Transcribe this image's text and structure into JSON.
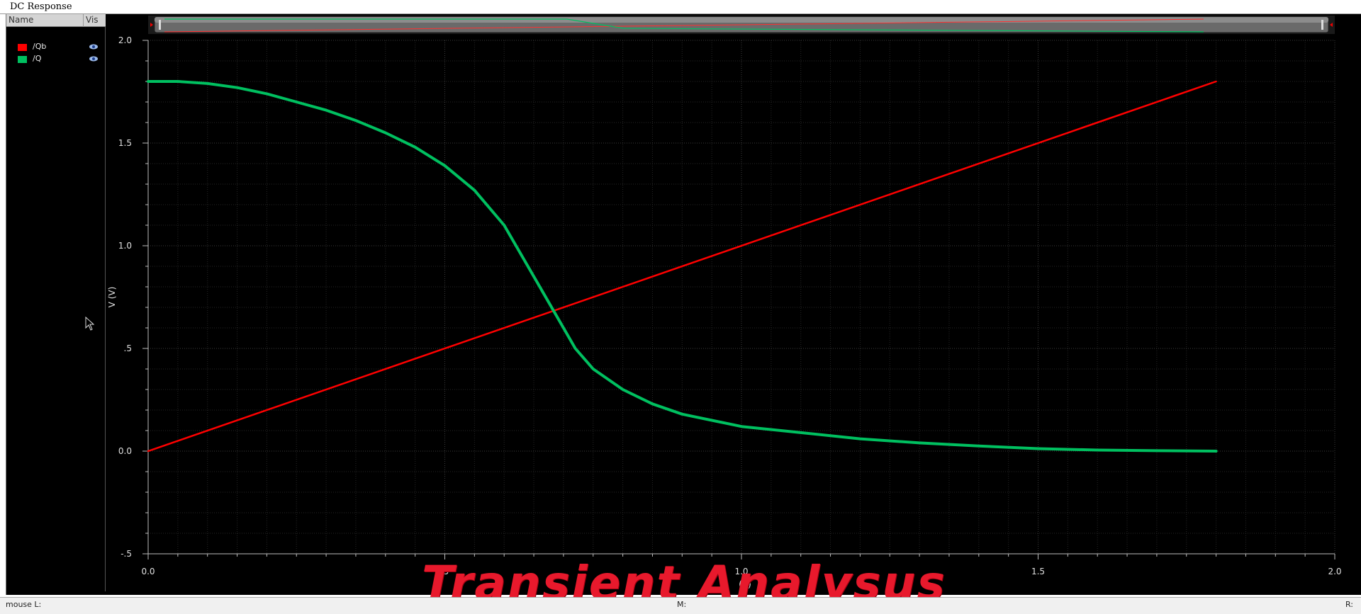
{
  "window": {
    "title": "DC Response"
  },
  "legend": {
    "headers": {
      "name": "Name",
      "vis": "Vis"
    },
    "items": [
      {
        "label": "/Qb",
        "color": "#ff0000",
        "icon": "eye-icon"
      },
      {
        "label": "/Q",
        "color": "#00c060",
        "icon": "eye-icon"
      }
    ]
  },
  "status": {
    "left": "mouse L:",
    "middle": "M:",
    "right": "R:"
  },
  "overlay_caption": "Transient Analysus",
  "chart_data": {
    "type": "line",
    "xlabel": "(V)",
    "ylabel": "V (V)",
    "xlim": [
      0,
      2.0
    ],
    "ylim": [
      -0.5,
      2.0
    ],
    "x_ticks": [
      {
        "value": 0.0,
        "label": "0.0"
      },
      {
        "value": 0.5,
        "label": ".5"
      },
      {
        "value": 1.0,
        "label": "1.0"
      },
      {
        "value": 1.5,
        "label": "1.5"
      },
      {
        "value": 2.0,
        "label": "2.0"
      }
    ],
    "y_ticks": [
      {
        "value": -0.5,
        "label": "-.5"
      },
      {
        "value": 0.0,
        "label": "0.0"
      },
      {
        "value": 0.5,
        "label": ".5"
      },
      {
        "value": 1.0,
        "label": "1.0"
      },
      {
        "value": 1.5,
        "label": "1.5"
      },
      {
        "value": 2.0,
        "label": "2.0"
      }
    ],
    "grid": true,
    "background": "#000000",
    "series": [
      {
        "name": "/Qb",
        "color": "#ff0000",
        "points": [
          [
            0.0,
            0.0
          ],
          [
            1.8,
            1.8
          ]
        ]
      },
      {
        "name": "/Q",
        "color": "#00c060",
        "points": [
          [
            0.0,
            1.8
          ],
          [
            0.05,
            1.8
          ],
          [
            0.1,
            1.79
          ],
          [
            0.15,
            1.77
          ],
          [
            0.2,
            1.74
          ],
          [
            0.25,
            1.7
          ],
          [
            0.3,
            1.66
          ],
          [
            0.35,
            1.61
          ],
          [
            0.4,
            1.55
          ],
          [
            0.45,
            1.48
          ],
          [
            0.5,
            1.39
          ],
          [
            0.55,
            1.27
          ],
          [
            0.6,
            1.1
          ],
          [
            0.65,
            0.85
          ],
          [
            0.7,
            0.6
          ],
          [
            0.72,
            0.5
          ],
          [
            0.75,
            0.4
          ],
          [
            0.8,
            0.3
          ],
          [
            0.85,
            0.23
          ],
          [
            0.9,
            0.18
          ],
          [
            0.95,
            0.15
          ],
          [
            1.0,
            0.12
          ],
          [
            1.1,
            0.09
          ],
          [
            1.2,
            0.06
          ],
          [
            1.3,
            0.04
          ],
          [
            1.4,
            0.025
          ],
          [
            1.5,
            0.012
          ],
          [
            1.6,
            0.005
          ],
          [
            1.7,
            0.002
          ],
          [
            1.8,
            0.0
          ]
        ]
      }
    ]
  }
}
